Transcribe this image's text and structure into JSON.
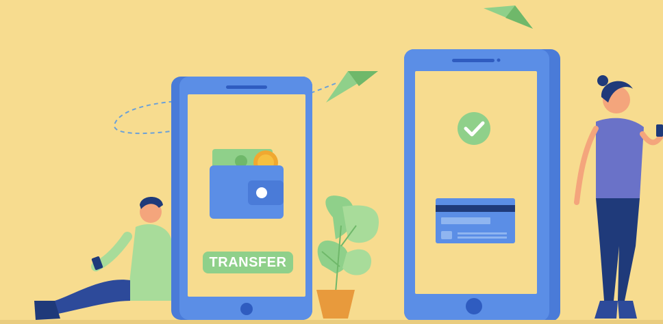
{
  "scene": {
    "transfer_button_label": "TRANSFER"
  },
  "colors": {
    "background": "#f7dc8f",
    "phone_body": "#5b8ee6",
    "phone_screen": "#f7dc8f",
    "accent_green": "#8fd08a",
    "card_blue": "#5b8ee6",
    "dark_navy": "#1f3a7a"
  },
  "icons": [
    "paper-plane-icon",
    "wallet-icon",
    "coin-icon",
    "checkmark-icon",
    "credit-card-icon",
    "smartphone-icon"
  ]
}
